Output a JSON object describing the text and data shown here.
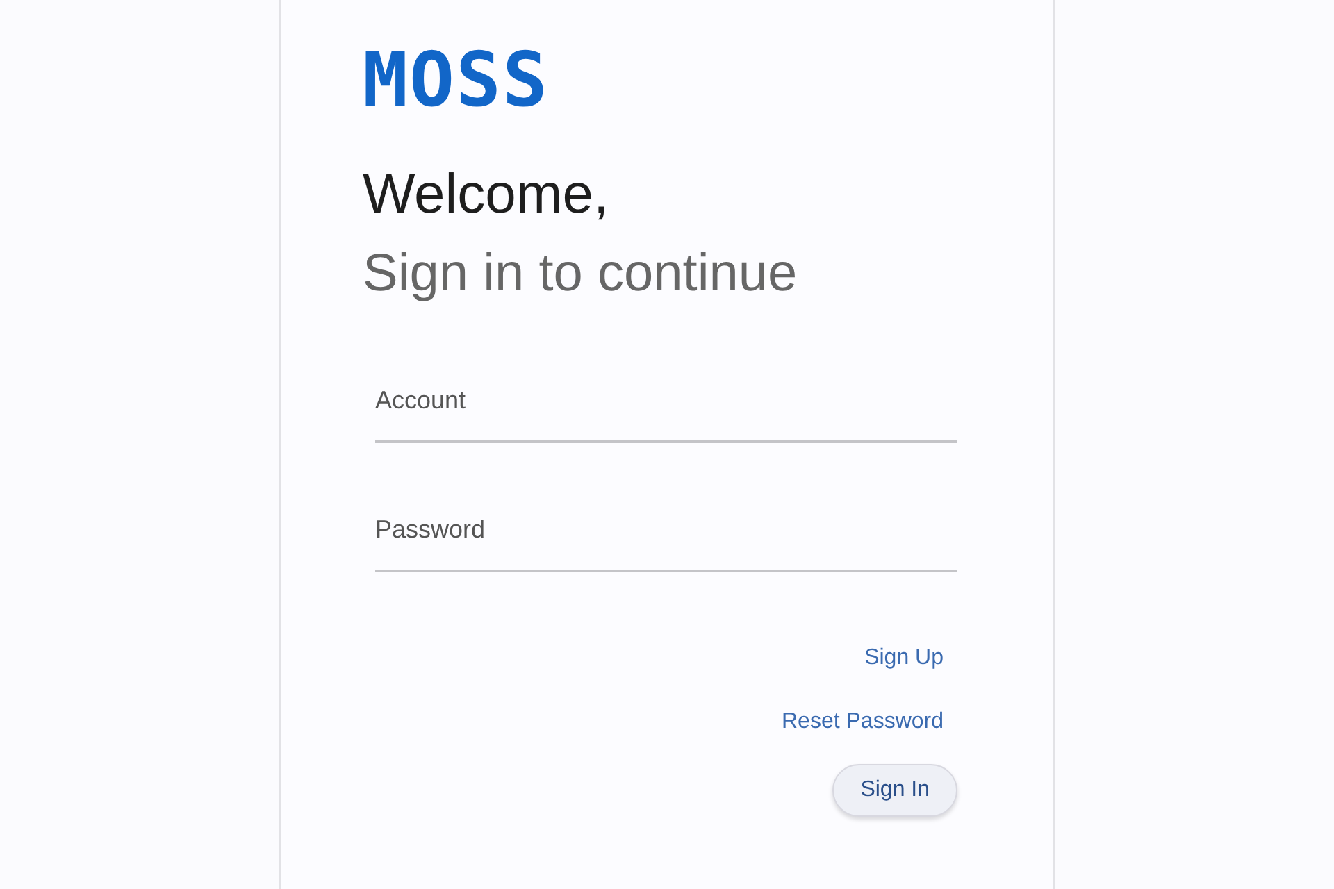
{
  "logo": "MOSS",
  "heading": "Welcome,",
  "subheading": "Sign in to continue",
  "fields": [
    {
      "placeholder": "Account"
    },
    {
      "placeholder": "Password"
    }
  ],
  "links": [
    "Sign Up",
    "Reset Password"
  ],
  "submit": "Sign In"
}
